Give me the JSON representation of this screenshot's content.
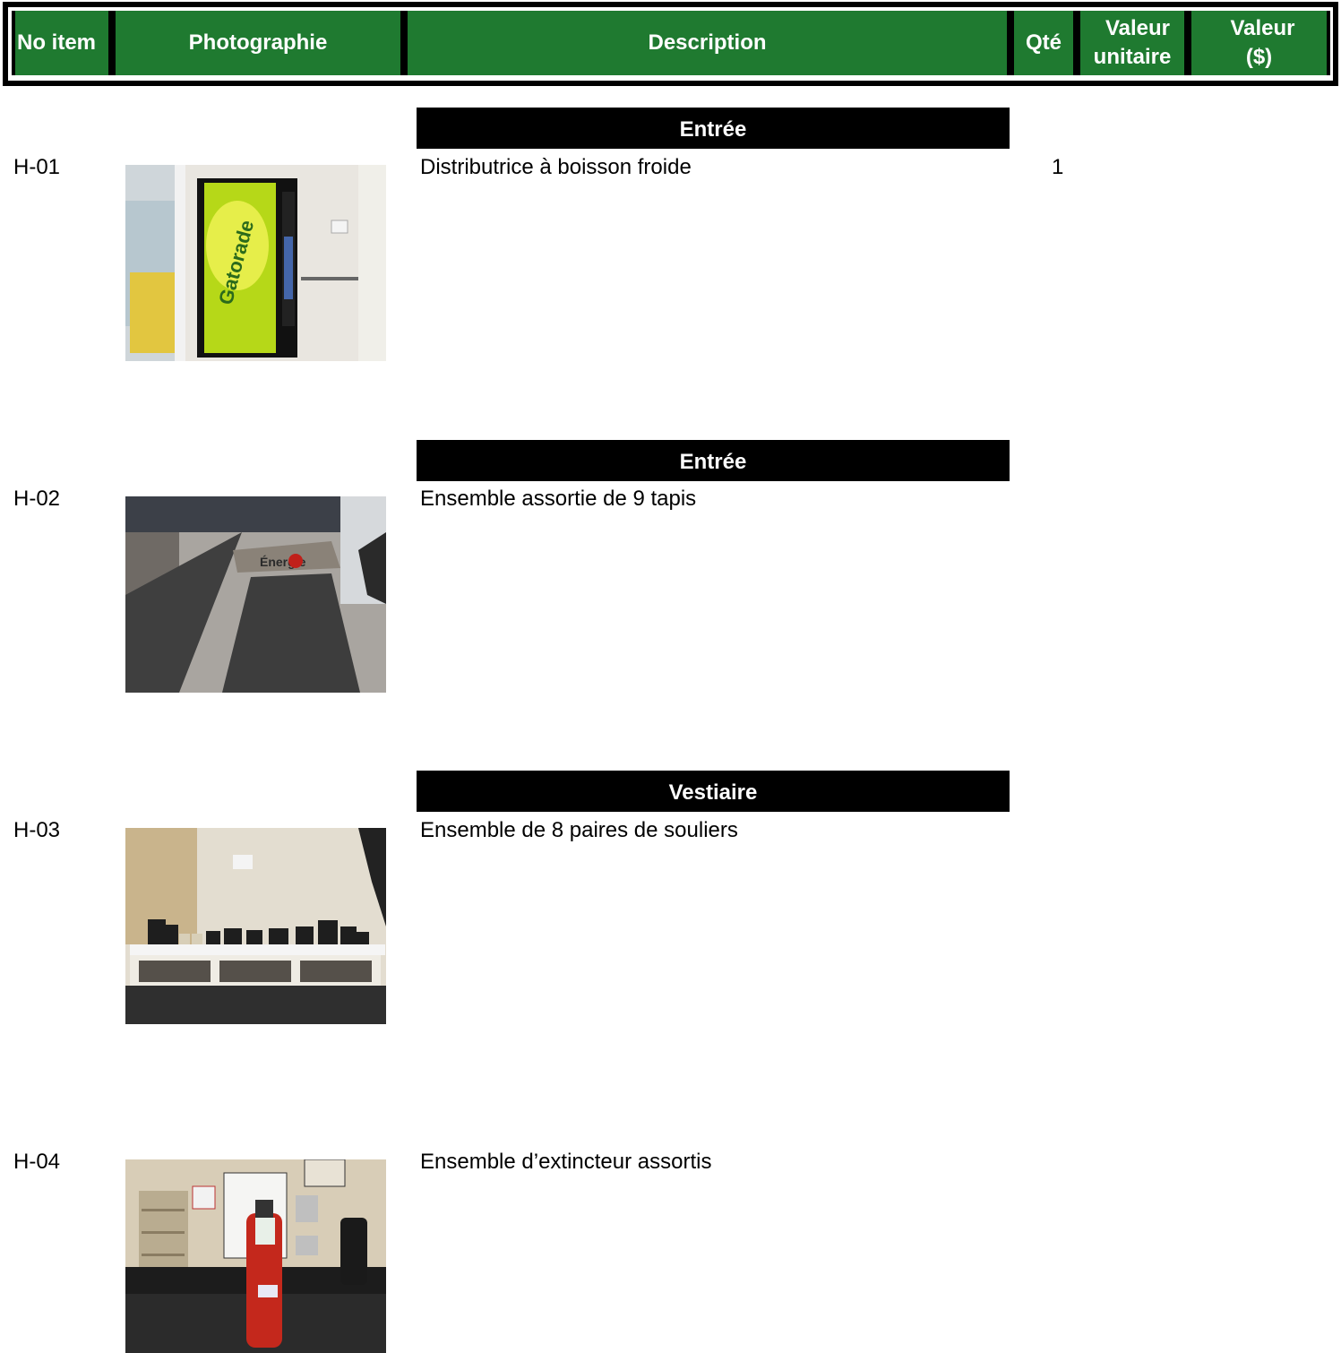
{
  "header": {
    "no_item": "No item",
    "photographie": "Photographie",
    "description": "Description",
    "qte": "Qté",
    "valeur_unitaire_line1": "Valeur",
    "valeur_unitaire_line2": "unitaire",
    "valeur_line1": "Valeur",
    "valeur_line2": "($)"
  },
  "items": [
    {
      "no": "H-01",
      "section": "Entrée",
      "description": "Distributrice à boisson froide",
      "qty": "1",
      "photo": "vending-machine-photo"
    },
    {
      "no": "H-02",
      "section": "Entrée",
      "description": "Ensemble assortie de 9 tapis",
      "qty": "",
      "photo": "floor-mats-photo"
    },
    {
      "no": "H-03",
      "section": "Vestiaire",
      "description": "Ensemble de 8 paires de souliers",
      "qty": "",
      "photo": "shoes-bench-photo"
    },
    {
      "no": "H-04",
      "section": "",
      "description": "Ensemble d’extincteur assortis",
      "qty": "",
      "photo": "fire-extinguisher-photo"
    }
  ],
  "colors": {
    "header_green": "#1f7a30",
    "section_black": "#000000"
  }
}
